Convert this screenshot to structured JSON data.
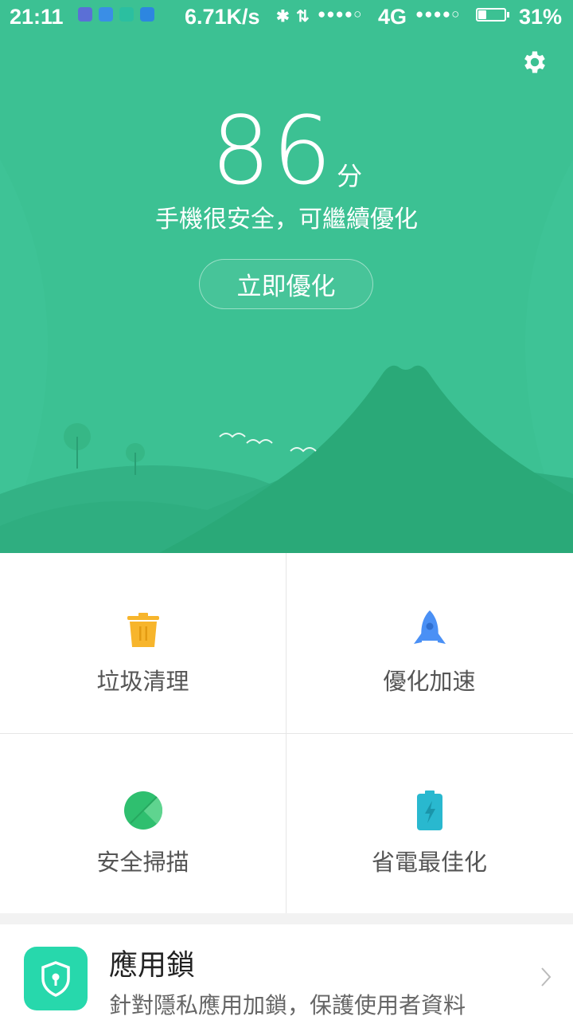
{
  "status_bar": {
    "time": "21:11",
    "net_speed": "6.71K/s",
    "network_type": "4G",
    "battery_percent": "31%",
    "battery_level": 0.31,
    "signal_1": "●●●●○",
    "signal_2": "●●●●○",
    "bluetooth_icon": "bluetooth-icon",
    "data_arrows_icon": "data-transfer-icon"
  },
  "header": {
    "settings_icon": "gear-icon",
    "score": "86",
    "score_unit": "分",
    "status_message": "手機很安全，可繼續優化",
    "optimize_button": "立即優化"
  },
  "tools": [
    {
      "label": "垃圾清理",
      "icon": "trash-icon",
      "color": "#f7b52c"
    },
    {
      "label": "優化加速",
      "icon": "rocket-icon",
      "color": "#4a90f5"
    },
    {
      "label": "安全掃描",
      "icon": "scan-icon",
      "color": "#2fbf6f"
    },
    {
      "label": "省電最佳化",
      "icon": "battery-icon",
      "color": "#29b8cf"
    }
  ],
  "app_lock": {
    "title": "應用鎖",
    "description": "針對隱私應用加鎖，保護使用者資料",
    "icon": "shield-lock-icon",
    "color": "#27d8ac"
  },
  "colors": {
    "hero_background": "#3cc193"
  }
}
